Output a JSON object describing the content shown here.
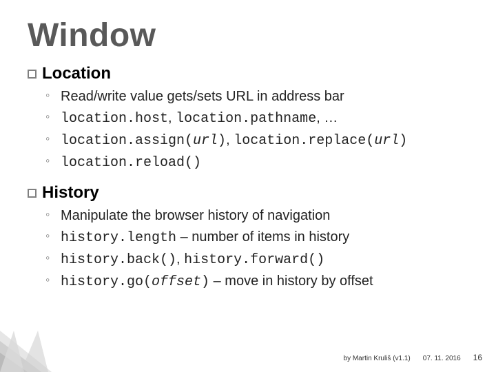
{
  "title": "Window",
  "sections": [
    {
      "heading": "Location",
      "items": [
        {
          "plain": "Read/write value gets/sets URL in address bar"
        },
        {
          "html": "<span class='mono'>location.host</span>, <span class='mono'>location.pathname</span>, …"
        },
        {
          "html": "<span class='mono'>location.assign(</span><span class='mono-italic'>url</span><span class='mono'>)</span>, <span class='mono'>location.replace(</span><span class='mono-italic'>url</span><span class='mono'>)</span>"
        },
        {
          "html": "<span class='mono'>location.reload()</span>"
        }
      ]
    },
    {
      "heading": "History",
      "items": [
        {
          "plain": "Manipulate the browser history of navigation"
        },
        {
          "html": "<span class='mono'>history.length</span> – number of items in history"
        },
        {
          "html": "<span class='mono'>history.back()</span>, <span class='mono'>history.forward()</span>"
        },
        {
          "html": "<span class='mono'>history.go(</span><span class='mono-italic'>offset</span><span class='mono'>)</span> – move in history by offset"
        }
      ]
    }
  ],
  "footer": {
    "author": "by Martin Kruliš (v1.1)",
    "date": "07. 11. 2016",
    "page": "16"
  }
}
